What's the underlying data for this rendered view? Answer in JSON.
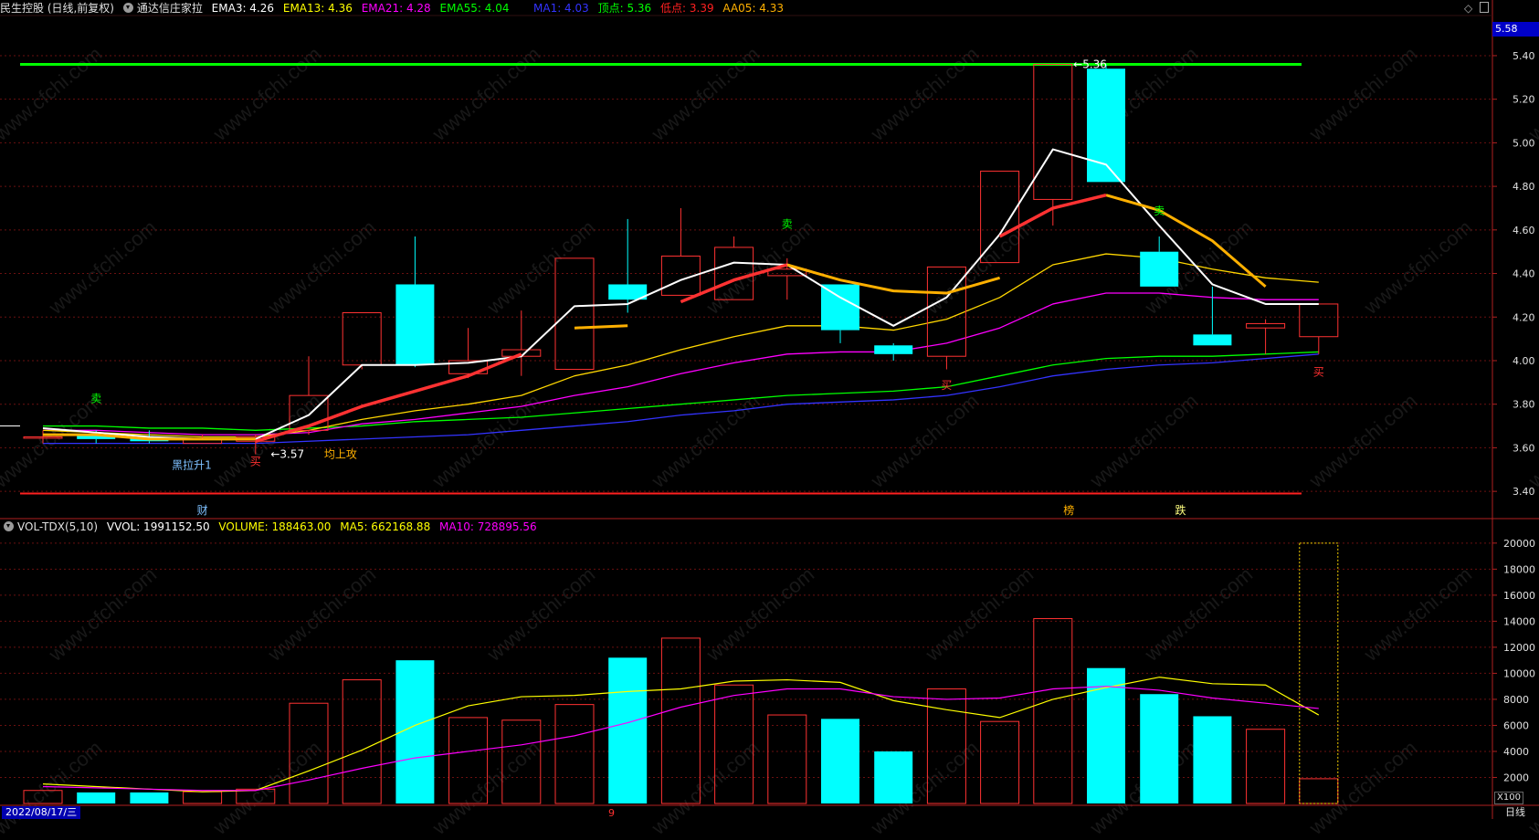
{
  "colors": {
    "up": "#ff3232",
    "down": "#00ffff",
    "ema3": "#ffffff",
    "ema13": "#ffd700",
    "ema21": "#ff00ff",
    "ema55": "#00ff00",
    "ma1": "#3333ff",
    "top": "#00ff00",
    "bottom": "#ff2020",
    "aa05": "#ffb000",
    "vma5": "#ffff00",
    "vma10": "#ff00ff"
  },
  "header": {
    "title": "民生控股 (日线,前复权)",
    "indicator": "通达信庄家拉",
    "items": [
      {
        "label": "EMA3: 4.26",
        "color": "#ffffff"
      },
      {
        "label": "EMA13: 4.36",
        "color": "#ffff00"
      },
      {
        "label": "EMA21: 4.28",
        "color": "#ff00ff"
      },
      {
        "label": "EMA55: 4.04",
        "color": "#00ff00"
      }
    ],
    "items2": [
      {
        "label": "MA1: 4.03",
        "color": "#3333ff"
      },
      {
        "label": "顶点: 5.36",
        "color": "#00ff00"
      },
      {
        "label": "低点: 3.39",
        "color": "#ff2020"
      },
      {
        "label": "AA05: 4.33",
        "color": "#ffb000"
      }
    ]
  },
  "vol_header": {
    "name": "VOL-TDX(5,10)",
    "items": [
      {
        "label": "VVOL: 1991152.50",
        "color": "#ffffff"
      },
      {
        "label": "VOLUME: 188463.00",
        "color": "#ffff00"
      },
      {
        "label": "MA5: 662168.88",
        "color": "#ffff00"
      },
      {
        "label": "MA10: 728895.56",
        "color": "#ff00ff"
      }
    ]
  },
  "price_axis": {
    "current": "5.58",
    "ticks": [
      "5.40",
      "5.20",
      "5.00",
      "4.80",
      "4.60",
      "4.40",
      "4.20",
      "4.00",
      "3.80",
      "3.60",
      "3.40"
    ]
  },
  "vol_axis": {
    "ticks": [
      "20000",
      "18000",
      "16000",
      "14000",
      "12000",
      "10000",
      "8000",
      "6000",
      "4000",
      "2000"
    ],
    "unit": "X100"
  },
  "date_label": "2022/08/17/三",
  "period_label": "日线",
  "month_mark": "9",
  "chart_data": {
    "type": "candlestick",
    "ylim": [
      3.3,
      5.58
    ],
    "vol_ylim": [
      0,
      20900
    ],
    "candles": [
      {
        "o": 3.65,
        "c": 3.65,
        "h": 3.68,
        "l": 3.62,
        "up": true
      },
      {
        "o": 3.66,
        "c": 3.64,
        "h": 3.68,
        "l": 3.62,
        "up": false
      },
      {
        "o": 3.65,
        "c": 3.63,
        "h": 3.68,
        "l": 3.62,
        "up": false
      },
      {
        "o": 3.62,
        "c": 3.64,
        "h": 3.66,
        "l": 3.62,
        "up": true
      },
      {
        "o": 3.63,
        "c": 3.65,
        "h": 3.66,
        "l": 3.57,
        "up": true
      },
      {
        "o": 3.68,
        "c": 3.84,
        "h": 4.02,
        "l": 3.66,
        "up": true
      },
      {
        "o": 3.98,
        "c": 4.22,
        "h": 4.22,
        "l": 3.96,
        "up": true
      },
      {
        "o": 4.35,
        "c": 3.98,
        "h": 4.57,
        "l": 3.97,
        "up": false
      },
      {
        "o": 3.94,
        "c": 4.0,
        "h": 4.15,
        "l": 3.92,
        "up": true
      },
      {
        "o": 4.02,
        "c": 4.05,
        "h": 4.23,
        "l": 3.93,
        "up": true
      },
      {
        "o": 3.96,
        "c": 4.47,
        "h": 4.47,
        "l": 3.96,
        "up": true
      },
      {
        "o": 4.35,
        "c": 4.28,
        "h": 4.65,
        "l": 4.22,
        "up": false
      },
      {
        "o": 4.3,
        "c": 4.48,
        "h": 4.7,
        "l": 4.3,
        "up": true
      },
      {
        "o": 4.28,
        "c": 4.52,
        "h": 4.57,
        "l": 4.28,
        "up": true
      },
      {
        "o": 4.39,
        "c": 4.42,
        "h": 4.47,
        "l": 4.28,
        "up": true
      },
      {
        "o": 4.35,
        "c": 4.14,
        "h": 4.35,
        "l": 4.08,
        "up": false
      },
      {
        "o": 4.07,
        "c": 4.03,
        "h": 4.08,
        "l": 4.0,
        "up": false
      },
      {
        "o": 4.02,
        "c": 4.43,
        "h": 4.43,
        "l": 3.96,
        "up": true
      },
      {
        "o": 4.45,
        "c": 4.87,
        "h": 4.87,
        "l": 4.45,
        "up": true
      },
      {
        "o": 4.74,
        "c": 5.36,
        "h": 5.36,
        "l": 4.62,
        "up": true
      },
      {
        "o": 5.34,
        "c": 4.82,
        "h": 5.36,
        "l": 4.82,
        "up": false
      },
      {
        "o": 4.5,
        "c": 4.34,
        "h": 4.57,
        "l": 4.34,
        "up": false
      },
      {
        "o": 4.12,
        "c": 4.07,
        "h": 4.34,
        "l": 4.07,
        "up": false
      },
      {
        "o": 4.15,
        "c": 4.17,
        "h": 4.19,
        "l": 4.03,
        "up": true
      },
      {
        "o": 4.11,
        "c": 4.26,
        "h": 4.26,
        "l": 4.03,
        "up": true
      }
    ],
    "volumes": [
      1000,
      850,
      850,
      900,
      1100,
      7700,
      9500,
      11000,
      6600,
      6400,
      7600,
      11200,
      12700,
      9100,
      6800,
      6500,
      4000,
      8800,
      6300,
      14200,
      10400,
      8400,
      6700,
      5700,
      1900
    ],
    "vol_ma5": [
      1500,
      1300,
      1100,
      900,
      1000,
      2500,
      4100,
      6000,
      7500,
      8200,
      8300,
      8600,
      8800,
      9400,
      9500,
      9300,
      7900,
      7200,
      6600,
      8000,
      8900,
      9700,
      9200,
      9100,
      6800
    ],
    "vol_ma10": [
      1300,
      1200,
      1100,
      1000,
      1000,
      1800,
      2700,
      3500,
      4000,
      4500,
      5200,
      6200,
      7400,
      8300,
      8800,
      8800,
      8200,
      8000,
      8100,
      8800,
      9000,
      8700,
      8100,
      7700,
      7300
    ],
    "vol_ghost": 20000,
    "ema3": [
      3.69,
      3.67,
      3.65,
      3.64,
      3.64,
      3.75,
      3.98,
      3.98,
      3.99,
      4.02,
      4.25,
      4.26,
      4.37,
      4.45,
      4.44,
      4.29,
      4.16,
      4.29,
      4.58,
      4.97,
      4.9,
      4.62,
      4.35,
      4.26,
      4.26
    ],
    "ema13": [
      3.68,
      3.67,
      3.66,
      3.65,
      3.65,
      3.68,
      3.73,
      3.77,
      3.8,
      3.84,
      3.93,
      3.98,
      4.05,
      4.11,
      4.16,
      4.16,
      4.14,
      4.19,
      4.29,
      4.44,
      4.49,
      4.47,
      4.42,
      4.38,
      4.36
    ],
    "ema21": [
      3.68,
      3.68,
      3.67,
      3.66,
      3.66,
      3.67,
      3.71,
      3.73,
      3.76,
      3.79,
      3.84,
      3.88,
      3.94,
      3.99,
      4.03,
      4.04,
      4.04,
      4.08,
      4.15,
      4.26,
      4.31,
      4.31,
      4.29,
      4.28,
      4.28
    ],
    "ema55": [
      3.7,
      3.7,
      3.69,
      3.69,
      3.68,
      3.69,
      3.7,
      3.72,
      3.73,
      3.74,
      3.76,
      3.78,
      3.8,
      3.82,
      3.84,
      3.85,
      3.86,
      3.88,
      3.93,
      3.98,
      4.01,
      4.02,
      4.02,
      4.03,
      4.04
    ],
    "ma1": [
      3.62,
      3.62,
      3.62,
      3.62,
      3.62,
      3.63,
      3.64,
      3.65,
      3.66,
      3.68,
      3.7,
      3.72,
      3.75,
      3.77,
      3.8,
      3.81,
      3.82,
      3.84,
      3.88,
      3.93,
      3.96,
      3.98,
      3.99,
      4.01,
      4.03
    ],
    "redline": [
      null,
      null,
      null,
      null,
      3.63,
      3.7,
      3.79,
      3.86,
      3.93,
      4.03,
      null,
      null,
      4.27,
      4.37,
      4.44,
      null,
      null,
      null,
      4.57,
      4.7,
      4.76,
      null,
      null,
      null,
      null
    ],
    "goldline": [
      3.66,
      3.66,
      3.64,
      3.64,
      3.64,
      null,
      null,
      null,
      null,
      null,
      4.15,
      4.16,
      null,
      null,
      4.44,
      4.37,
      4.32,
      4.31,
      4.38,
      null,
      4.76,
      4.69,
      4.55,
      4.34,
      null
    ],
    "top_value": 5.36,
    "bottom_value": 3.39,
    "signals": [
      {
        "i": 1,
        "text": "卖",
        "color": "#00ff00",
        "y": 3.81
      },
      {
        "i": 4,
        "text": "买",
        "color": "#ff3030",
        "y": 3.52
      },
      {
        "i": 14,
        "text": "卖",
        "color": "#00ff00",
        "y": 4.61
      },
      {
        "i": 17,
        "text": "买",
        "color": "#ff3030",
        "y": 3.87
      },
      {
        "i": 21,
        "text": "卖",
        "color": "#00ff00",
        "y": 4.67
      },
      {
        "i": 24,
        "text": "买",
        "color": "#ff3030",
        "y": 3.93
      }
    ],
    "annotations": [
      {
        "text": "黑拉升1",
        "color": "#7ec0ff",
        "i": 2.8,
        "y": 3.52
      },
      {
        "text": "←3.57",
        "color": "#ffffff",
        "i": 4.6,
        "y": 3.57
      },
      {
        "text": "均上攻",
        "color": "#ffb000",
        "i": 5.6,
        "y": 3.57
      },
      {
        "text": "←5.36",
        "color": "#ffffff",
        "i": 19.7,
        "y": 5.36
      }
    ],
    "bottom_marks": [
      {
        "text": "财",
        "color": "#7ec0ff",
        "i": 3.0
      },
      {
        "text": "榜",
        "color": "#ffb000",
        "i": 19.3
      },
      {
        "text": "跌",
        "color": "#ffff80",
        "i": 21.4
      }
    ]
  }
}
